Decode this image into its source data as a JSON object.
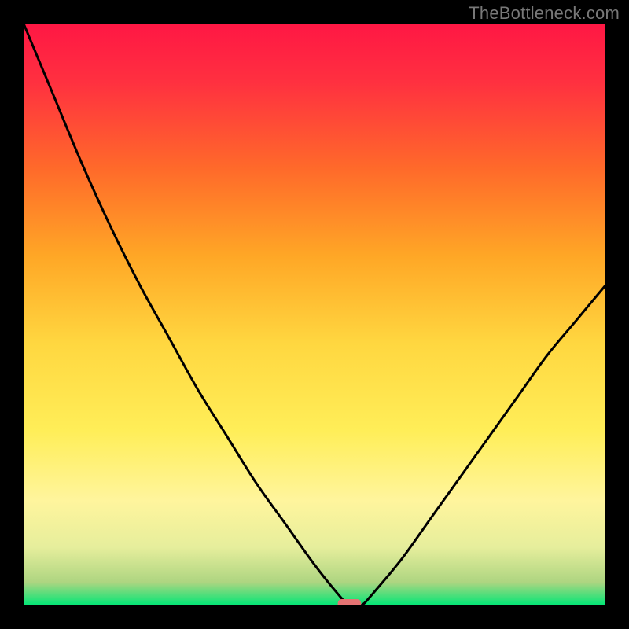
{
  "attribution": "TheBottleneck.com",
  "chart_data": {
    "type": "line",
    "title": "",
    "xlabel": "",
    "ylabel": "",
    "xlim": [
      0,
      100
    ],
    "ylim": [
      0,
      100
    ],
    "x": [
      0,
      5,
      10,
      15,
      20,
      25,
      30,
      35,
      40,
      45,
      50,
      54,
      56,
      58,
      60,
      65,
      70,
      75,
      80,
      85,
      90,
      95,
      100
    ],
    "values": [
      100,
      88,
      76,
      65,
      55,
      46,
      37,
      29,
      21,
      14,
      7,
      2,
      0,
      0,
      2,
      8,
      15,
      22,
      29,
      36,
      43,
      49,
      55
    ],
    "marker": {
      "x_start": 54,
      "x_end": 58,
      "y": 0,
      "color": "#e57373"
    },
    "background_gradient": {
      "stops": [
        {
          "offset": 0.0,
          "color": "#ff1744"
        },
        {
          "offset": 0.1,
          "color": "#ff3040"
        },
        {
          "offset": 0.25,
          "color": "#ff6a2a"
        },
        {
          "offset": 0.4,
          "color": "#ffa726"
        },
        {
          "offset": 0.55,
          "color": "#ffd740"
        },
        {
          "offset": 0.7,
          "color": "#ffee58"
        },
        {
          "offset": 0.82,
          "color": "#fff59d"
        },
        {
          "offset": 0.9,
          "color": "#e6ee9c"
        },
        {
          "offset": 0.96,
          "color": "#aed581"
        },
        {
          "offset": 1.0,
          "color": "#00e676"
        }
      ]
    }
  }
}
